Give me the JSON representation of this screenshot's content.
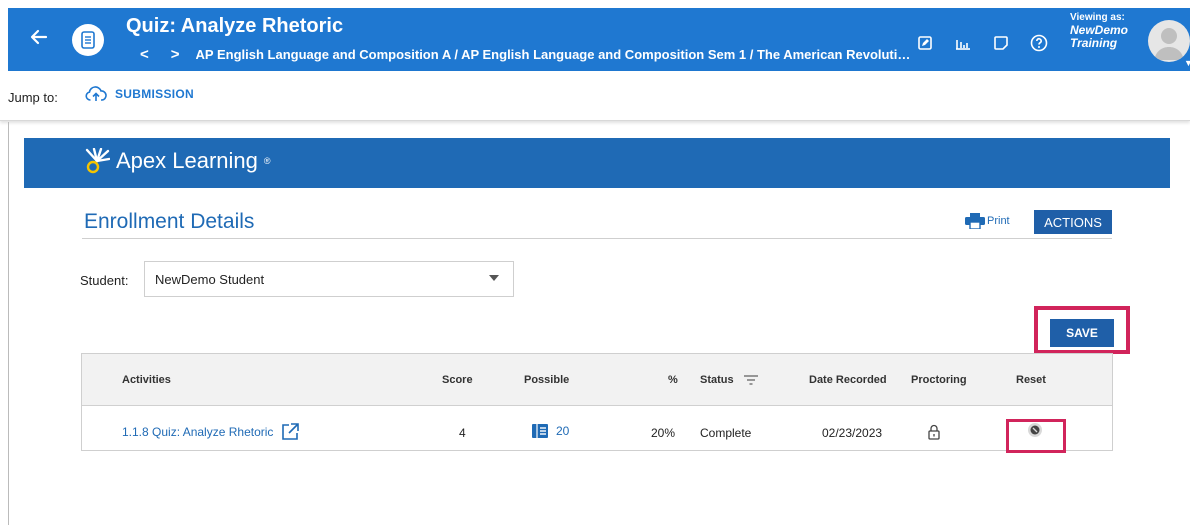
{
  "header": {
    "title": "Quiz: Analyze Rhetoric",
    "nav_prev": "<",
    "nav_next": ">",
    "breadcrumb": "AP English Language and Composition A / AP English Language and Composition Sem 1 / The American Revolution / Incr...",
    "viewing_as_label": "Viewing as:",
    "viewing_as_name_1": "NewDemo",
    "viewing_as_name_2": "Training"
  },
  "jump": {
    "label": "Jump to:",
    "link": "SUBMISSION"
  },
  "brand": {
    "name": "Apex Learning",
    "reg": "®"
  },
  "page": {
    "title": "Enrollment Details",
    "print": "Print",
    "actions": "ACTIONS",
    "save": "SAVE"
  },
  "student": {
    "label": "Student:",
    "selected": "NewDemo Student"
  },
  "table": {
    "headers": {
      "activities": "Activities",
      "score": "Score",
      "possible": "Possible",
      "percent": "%",
      "status": "Status",
      "date": "Date Recorded",
      "proctoring": "Proctoring",
      "reset": "Reset"
    },
    "rows": [
      {
        "activity": "1.1.8 Quiz: Analyze Rhetoric",
        "score": "4",
        "possible": "20",
        "percent": "20%",
        "status": "Complete",
        "date": "02/23/2023"
      }
    ]
  },
  "colors": {
    "header_blue": "#1f78d1",
    "banner_blue": "#1f6ab5",
    "highlight": "#d1245b"
  },
  "icons": {
    "back": "arrow-left-icon",
    "app": "document-icon",
    "jump": "cloud-upload-icon",
    "print": "printer-icon",
    "external": "external-link-icon",
    "possible": "list-book-icon",
    "proctoring": "lock-icon",
    "reset": "reset-icon",
    "filter": "filter-icon"
  }
}
